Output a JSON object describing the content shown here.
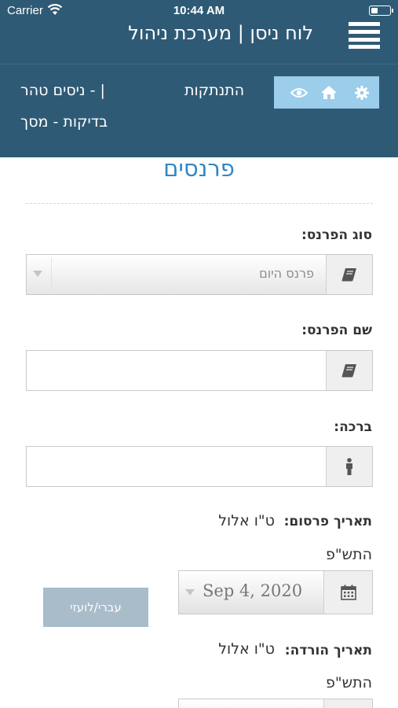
{
  "status_bar": {
    "carrier": "Carrier",
    "time": "10:44 AM"
  },
  "header": {
    "title": "לוח ניסן | מערכת ניהול",
    "logout_label": "התנתקות",
    "org_line1": "ניסים טהר - |",
    "org_line2": "בדיקות - מסך",
    "toolbar_icons": [
      "gear-icon",
      "home-icon",
      "eye-icon"
    ]
  },
  "page": {
    "title": "פרנסים",
    "form": {
      "sponsor_type": {
        "label": "סוג הפרנס:",
        "selected": "פרנס היום"
      },
      "sponsor_name": {
        "label": "שם הפרנס:",
        "value": ""
      },
      "blessing": {
        "label": "ברכה:",
        "value": ""
      },
      "publish_date": {
        "label": "תאריך פרסום:",
        "hebrew_date": "ט\"ו אלול",
        "hebrew_year": "התש\"פ",
        "value": "Sep 4, 2020"
      },
      "calendar_toggle_label": "עברי/לועזי",
      "remove_date": {
        "label": "תאריך הורדה:",
        "hebrew_date": "ט\"ו אלול",
        "hebrew_year": "התש\"פ"
      }
    }
  },
  "colors": {
    "header_bg": "#2f5a75",
    "toolbar_bg": "#9ccdea",
    "title": "#2f87c5",
    "toggle_bg": "#a9bcc9"
  }
}
